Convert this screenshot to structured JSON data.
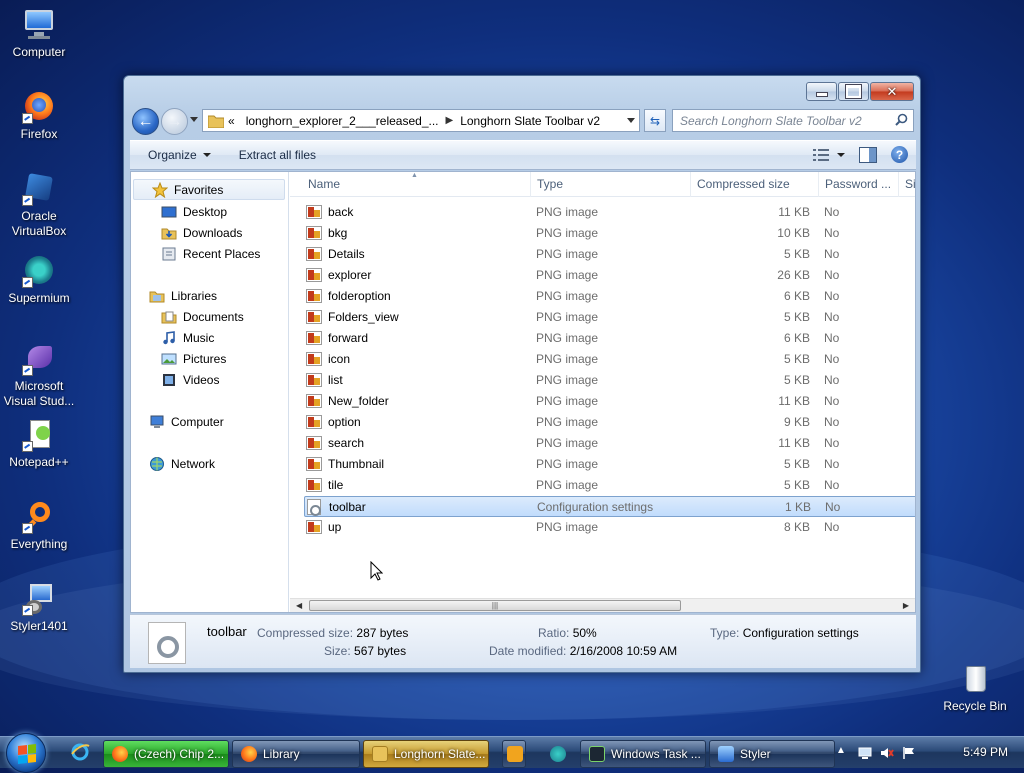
{
  "desktop": {
    "icons": [
      {
        "label": "Computer"
      },
      {
        "label": "Firefox"
      },
      {
        "label": "Oracle VirtualBox"
      },
      {
        "label": "Supermium"
      },
      {
        "label": "Microsoft Visual Stud..."
      },
      {
        "label": "Notepad++"
      },
      {
        "label": "Everything"
      },
      {
        "label": "Styler1401"
      },
      {
        "label": "Recycle Bin"
      }
    ]
  },
  "window": {
    "address": {
      "overflow": "«",
      "crumbs": [
        "longhorn_explorer_2___released_...",
        "Longhorn Slate Toolbar v2"
      ]
    },
    "search_placeholder": "Search Longhorn Slate Toolbar v2",
    "toolbar": {
      "organize": "Organize",
      "extract": "Extract all files"
    },
    "nav": {
      "favorites": "Favorites",
      "desktop": "Desktop",
      "downloads": "Downloads",
      "recent": "Recent Places",
      "libraries": "Libraries",
      "documents": "Documents",
      "music": "Music",
      "pictures": "Pictures",
      "videos": "Videos",
      "computer": "Computer",
      "network": "Network"
    },
    "columns": {
      "name": "Name",
      "type": "Type",
      "compressed": "Compressed size",
      "password": "Password ...",
      "size": "Si"
    },
    "files": [
      {
        "name": "back",
        "type": "PNG image",
        "size": "11 KB",
        "pw": "No"
      },
      {
        "name": "bkg",
        "type": "PNG image",
        "size": "10 KB",
        "pw": "No"
      },
      {
        "name": "Details",
        "type": "PNG image",
        "size": "5 KB",
        "pw": "No"
      },
      {
        "name": "explorer",
        "type": "PNG image",
        "size": "26 KB",
        "pw": "No"
      },
      {
        "name": "folderoption",
        "type": "PNG image",
        "size": "6 KB",
        "pw": "No"
      },
      {
        "name": "Folders_view",
        "type": "PNG image",
        "size": "5 KB",
        "pw": "No"
      },
      {
        "name": "forward",
        "type": "PNG image",
        "size": "6 KB",
        "pw": "No"
      },
      {
        "name": "icon",
        "type": "PNG image",
        "size": "5 KB",
        "pw": "No"
      },
      {
        "name": "list",
        "type": "PNG image",
        "size": "5 KB",
        "pw": "No"
      },
      {
        "name": "New_folder",
        "type": "PNG image",
        "size": "11 KB",
        "pw": "No"
      },
      {
        "name": "option",
        "type": "PNG image",
        "size": "9 KB",
        "pw": "No"
      },
      {
        "name": "search",
        "type": "PNG image",
        "size": "11 KB",
        "pw": "No"
      },
      {
        "name": "Thumbnail",
        "type": "PNG image",
        "size": "5 KB",
        "pw": "No"
      },
      {
        "name": "tile",
        "type": "PNG image",
        "size": "5 KB",
        "pw": "No"
      },
      {
        "name": "toolbar",
        "type": "Configuration settings",
        "size": "1 KB",
        "pw": "No"
      },
      {
        "name": "up",
        "type": "PNG image",
        "size": "8 KB",
        "pw": "No"
      }
    ],
    "selected_file": "toolbar",
    "details": {
      "name": "toolbar",
      "compressed_label": "Compressed size:",
      "compressed_value": "287 bytes",
      "size_label": "Size:",
      "size_value": "567 bytes",
      "ratio_label": "Ratio:",
      "ratio_value": "50%",
      "modified_label": "Date modified:",
      "modified_value": "2/16/2008 10:59 AM",
      "type_label": "Type:",
      "type_value": "Configuration settings"
    }
  },
  "taskbar": {
    "buttons": [
      {
        "label": "(Czech) Chip 2..."
      },
      {
        "label": "Library"
      },
      {
        "label": "Longhorn Slate..."
      },
      {
        "label": "Windows Task ..."
      },
      {
        "label": "Styler"
      }
    ],
    "clock": "5:49 PM"
  }
}
